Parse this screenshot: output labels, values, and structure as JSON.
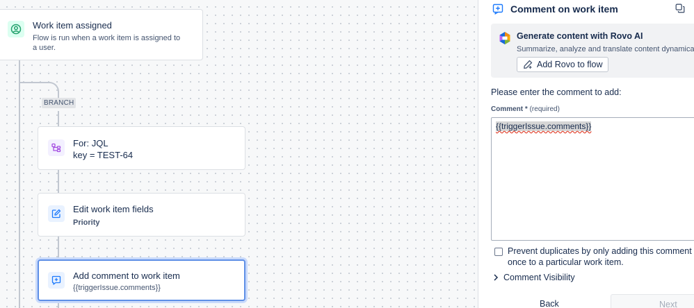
{
  "canvas": {
    "trigger": {
      "title": "Work item assigned",
      "subtitle": "Flow is run when a work item is assigned to a user."
    },
    "branch_label": "BRANCH",
    "for_card": {
      "title": "For: JQL",
      "subtitle": "key = TEST-64"
    },
    "edit_card": {
      "title": "Edit work item fields",
      "subtitle": "Priority"
    },
    "comment_card": {
      "title": "Add comment to work item",
      "subtitle": "{{triggerIssue.comments}}"
    }
  },
  "panel": {
    "title": "Comment on work item",
    "rovo": {
      "title": "Generate content with Rovo AI",
      "subtitle": "Summarize, analyze and translate content dynamically",
      "button_label": "Add Rovo to flow"
    },
    "prompt": "Please enter the comment to add:",
    "comment_field": {
      "label": "Comment",
      "required_marker": "*",
      "required_text": "(required)",
      "value": "{{triggerIssue.comments}}"
    },
    "prevent_duplicates": {
      "label": "Prevent duplicates by only adding this comment once to a particular work item.",
      "checked": false
    },
    "visibility_label": "Comment Visibility",
    "back_label": "Back",
    "next_label": "Next"
  },
  "colors": {
    "accent": "#5e8fe6",
    "trigger_icon": "#22a06b",
    "branch_icon": "#a54ee1",
    "action_icon": "#1d7afc"
  },
  "icons": {
    "trigger": "user-circle-icon",
    "for_card": "branch-icon",
    "edit_card": "edit-icon",
    "comment_card": "comment-add-icon",
    "panel": "comment-add-icon",
    "copy": "copy-icon",
    "rovo": "rovo-logo-icon",
    "rovo_button": "pencil-sparkle-icon",
    "visibility": "chevron-right-icon"
  }
}
